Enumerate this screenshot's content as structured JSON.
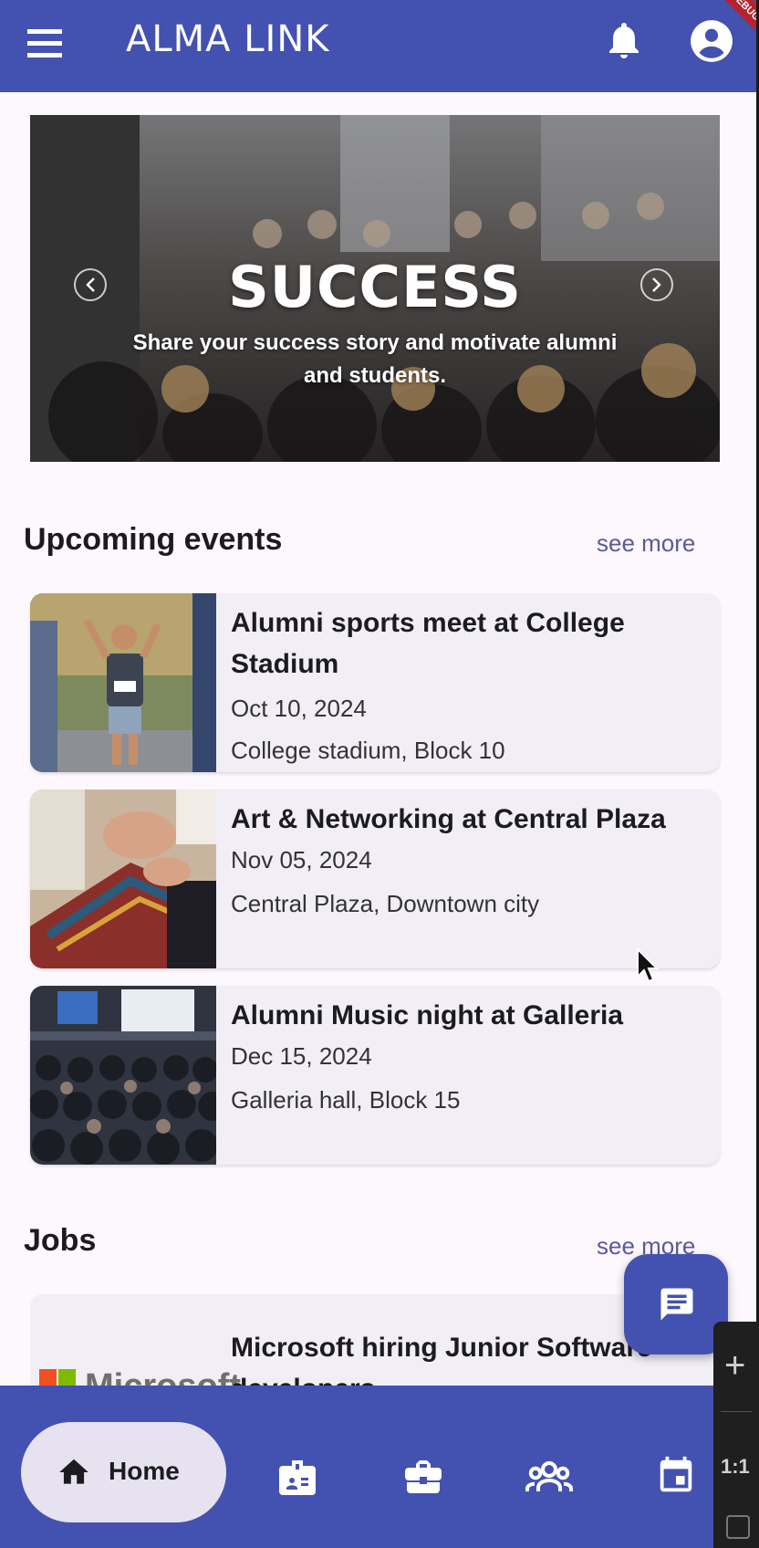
{
  "app_bar": {
    "title": "ALMA LINK",
    "debug_label": "DEBUG",
    "color": "#4352b0"
  },
  "hero": {
    "title": "SUCCESS",
    "subtitle": "Share your success story and motivate alumni and students."
  },
  "events": {
    "heading": "Upcoming events",
    "see_more": "see more",
    "items": [
      {
        "title": "Alumni sports meet at College Stadium",
        "date": "Oct 10, 2024",
        "location": "College stadium, Block 10"
      },
      {
        "title": "Art & Networking at Central Plaza",
        "date": "Nov 05, 2024",
        "location": "Central Plaza, Downtown city"
      },
      {
        "title": "Alumni Music night at Galleria",
        "date": "Dec 15, 2024",
        "location": "Galleria hall, Block 15"
      }
    ]
  },
  "jobs": {
    "heading": "Jobs",
    "see_more": "see more",
    "items": [
      {
        "company": "Microsoft",
        "title": "Microsoft hiring Junior Software developers"
      }
    ]
  },
  "bottom_nav": {
    "items": [
      {
        "label": "Home",
        "icon": "home-icon",
        "active": true
      },
      {
        "label": "",
        "icon": "badge-icon"
      },
      {
        "label": "",
        "icon": "briefcase-icon"
      },
      {
        "label": "",
        "icon": "community-icon"
      },
      {
        "label": "",
        "icon": "calendar-icon"
      }
    ]
  },
  "emulator_toolbar": {
    "ratio_label": "1:1"
  }
}
